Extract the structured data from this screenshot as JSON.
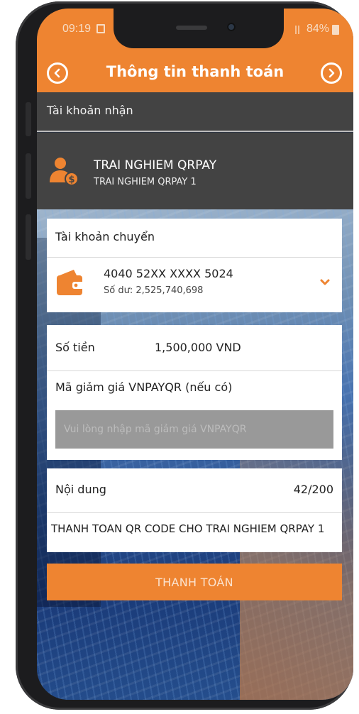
{
  "status_bar": {
    "time": "09:19",
    "battery": "84%"
  },
  "header": {
    "title": "Thông tin thanh toán"
  },
  "receiver": {
    "label": "Tài khoản nhận",
    "name": "TRAI NGHIEM QRPAY",
    "sub_name": "TRAI NGHIEM QRPAY 1"
  },
  "source_account": {
    "label": "Tài khoản chuyển",
    "account_number": "4040 52XX XXXX 5024",
    "balance": "Số dư: 2,525,740,698"
  },
  "amount": {
    "label": "Số tiền",
    "value": "1,500,000 VND"
  },
  "voucher": {
    "label": "Mã giảm giá VNPAYQR (nếu có)",
    "placeholder": "Vui lòng nhập mã giảm giá VNPAYQR",
    "value": ""
  },
  "content": {
    "label": "Nội dung",
    "counter": "42/200",
    "text": "THANH TOAN QR CODE CHO TRAI NGHIEM QRPAY 1"
  },
  "pay_button": {
    "label": "THANH TOÁN"
  },
  "colors": {
    "accent": "#ee8431",
    "header_dark": "#434343",
    "input_gray": "#999999"
  },
  "icons": {
    "back": "chevron-left-circle-icon",
    "next": "chevron-right-circle-icon",
    "receiver": "user-money-icon",
    "wallet": "wallet-icon",
    "dropdown": "chevron-down-icon"
  }
}
